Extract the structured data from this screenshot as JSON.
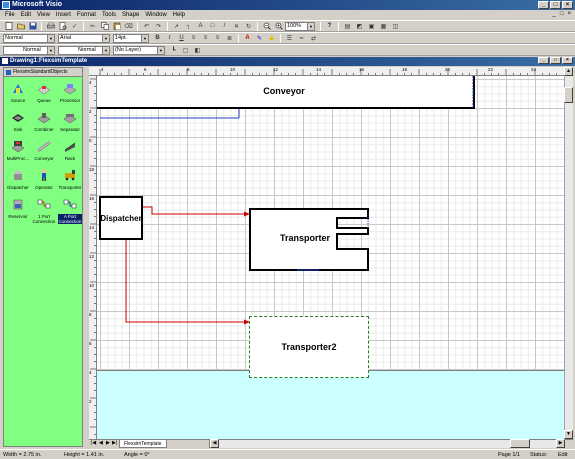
{
  "app": {
    "title": "Microsoft Visio"
  },
  "menu": [
    "File",
    "Edit",
    "View",
    "Insert",
    "Format",
    "Tools",
    "Shape",
    "Window",
    "Help"
  ],
  "toolbar": {
    "zoom": "100%",
    "style": "Normal",
    "font": "Arial",
    "font_size": "14pt.",
    "line_style": "Normal",
    "fill_style": "Normal",
    "layer": "(No Layer)",
    "bold": "B",
    "italic": "I",
    "underline": "U",
    "help": "?"
  },
  "document": {
    "title": "Drawing1:FlexsimTemplate"
  },
  "stencil": {
    "title": "FlexsimStandardObjects",
    "items": [
      {
        "label": "Source",
        "icon": "source-icon"
      },
      {
        "label": "Queue",
        "icon": "queue-icon"
      },
      {
        "label": "Processor",
        "icon": "processor-icon"
      },
      {
        "label": "Sink",
        "icon": "sink-icon"
      },
      {
        "label": "Combiner",
        "icon": "combiner-icon"
      },
      {
        "label": "Separator",
        "icon": "separator-icon"
      },
      {
        "label": "MultiProc...",
        "icon": "multiprocessor-icon"
      },
      {
        "label": "Conveyor",
        "icon": "conveyor-icon"
      },
      {
        "label": "Rack",
        "icon": "rack-icon"
      },
      {
        "label": "Dispatcher",
        "icon": "dispatcher-icon"
      },
      {
        "label": "Operator",
        "icon": "operator-icon"
      },
      {
        "label": "Transporter",
        "icon": "transporter-icon"
      },
      {
        "label": "Reservoir",
        "icon": "reservoir-icon"
      },
      {
        "label": "1 Port Connection",
        "icon": "one-port-connection-icon"
      },
      {
        "label": "A Port Connection",
        "icon": "a-port-connection-icon"
      }
    ]
  },
  "shapes": {
    "conveyor": "Conveyor",
    "dispatcher": "Dispatcher",
    "transporter": "Transporter",
    "transporter2": "Transporter2"
  },
  "ruler_top": [
    "4",
    "6",
    "8",
    "10",
    "12",
    "14",
    "16",
    "18",
    "20",
    "22",
    "24"
  ],
  "ruler_left": [
    "4",
    "2",
    "0",
    "18",
    "16",
    "14",
    "12",
    "10",
    "8",
    "6",
    "4",
    "2"
  ],
  "page_tab": "FlexsimTemplate",
  "status": {
    "width": "Width = 2.75 in.",
    "height": "Height = 1.41 in.",
    "angle": "Angle = 0°",
    "page": "Page 1/1",
    "status": "Status:",
    "mode": "Edit"
  },
  "colors": {
    "stencil_bg": "#80ff80",
    "floor": "#ccffff",
    "connector": "#cc0000",
    "title_bar": "#0a246a"
  }
}
